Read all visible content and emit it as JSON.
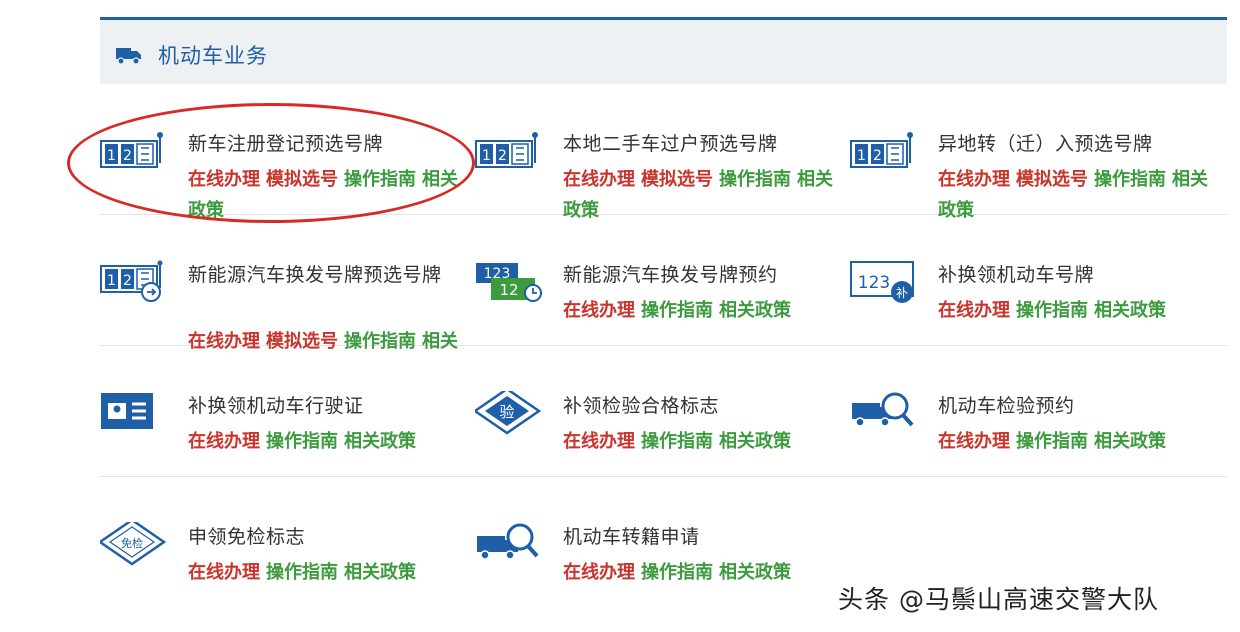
{
  "section": {
    "title": "机动车业务",
    "icon": "truck-icon"
  },
  "services": [
    {
      "title": "新车注册登记预选号牌",
      "icon": "plate-select-icon",
      "links": [
        {
          "label": "在线办理",
          "color": "red"
        },
        {
          "label": "模拟选号",
          "color": "red"
        },
        {
          "label": "操作指南",
          "color": "green"
        },
        {
          "label": "相关政策",
          "color": "green"
        }
      ]
    },
    {
      "title": "本地二手车过户预选号牌",
      "icon": "plate-select-icon",
      "links": [
        {
          "label": "在线办理",
          "color": "red"
        },
        {
          "label": "模拟选号",
          "color": "red"
        },
        {
          "label": "操作指南",
          "color": "green"
        },
        {
          "label": "相关政策",
          "color": "green"
        }
      ]
    },
    {
      "title": "异地转（迁）入预选号牌",
      "icon": "plate-select-icon",
      "links": [
        {
          "label": "在线办理",
          "color": "red"
        },
        {
          "label": "模拟选号",
          "color": "red"
        },
        {
          "label": "操作指南",
          "color": "green"
        },
        {
          "label": "相关政策",
          "color": "green"
        }
      ]
    },
    {
      "title": "新能源汽车换发号牌预选号牌",
      "icon": "plate-refresh-icon",
      "links": [
        {
          "label": "在线办理",
          "color": "red"
        },
        {
          "label": "模拟选号",
          "color": "red"
        },
        {
          "label": "操作指南",
          "color": "green"
        },
        {
          "label": "相关政策",
          "color": "green"
        }
      ]
    },
    {
      "title": "新能源汽车换发号牌预约",
      "icon": "plate-appointment-icon",
      "links": [
        {
          "label": "在线办理",
          "color": "red"
        },
        {
          "label": "操作指南",
          "color": "green"
        },
        {
          "label": "相关政策",
          "color": "green"
        }
      ]
    },
    {
      "title": "补换领机动车号牌",
      "icon": "plate-replace-icon",
      "links": [
        {
          "label": "在线办理",
          "color": "red"
        },
        {
          "label": "操作指南",
          "color": "green"
        },
        {
          "label": "相关政策",
          "color": "green"
        }
      ]
    },
    {
      "title": "补换领机动车行驶证",
      "icon": "license-card-icon",
      "links": [
        {
          "label": "在线办理",
          "color": "red"
        },
        {
          "label": "操作指南",
          "color": "green"
        },
        {
          "label": "相关政策",
          "color": "green"
        }
      ]
    },
    {
      "title": "补领检验合格标志",
      "icon": "inspection-badge-icon",
      "badge_text": "验",
      "links": [
        {
          "label": "在线办理",
          "color": "red"
        },
        {
          "label": "操作指南",
          "color": "green"
        },
        {
          "label": "相关政策",
          "color": "green"
        }
      ]
    },
    {
      "title": "机动车检验预约",
      "icon": "vehicle-inspection-icon",
      "links": [
        {
          "label": "在线办理",
          "color": "red"
        },
        {
          "label": "操作指南",
          "color": "green"
        },
        {
          "label": "相关政策",
          "color": "green"
        }
      ]
    },
    {
      "title": "申领免检标志",
      "icon": "exemption-badge-icon",
      "badge_text": "免检",
      "links": [
        {
          "label": "在线办理",
          "color": "red"
        },
        {
          "label": "操作指南",
          "color": "green"
        },
        {
          "label": "相关政策",
          "color": "green"
        }
      ]
    },
    {
      "title": "机动车转籍申请",
      "icon": "vehicle-transfer-icon",
      "links": [
        {
          "label": "在线办理",
          "color": "red"
        },
        {
          "label": "操作指南",
          "color": "green"
        },
        {
          "label": "相关政策",
          "color": "green"
        }
      ]
    }
  ],
  "watermark": "头条 @马鬃山高速交警大队",
  "colors": {
    "accent": "#1f5fa8",
    "link_red": "#c9342c",
    "link_green": "#3c9b3e",
    "highlight": "#d82a25"
  }
}
